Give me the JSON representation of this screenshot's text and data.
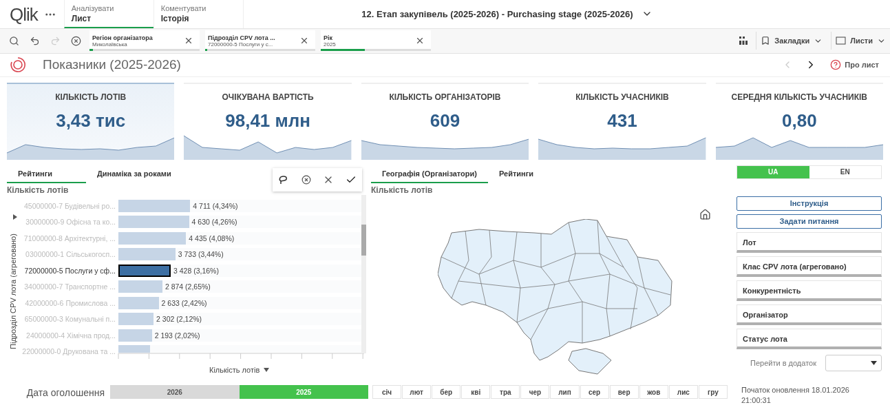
{
  "header": {
    "logo": "Qlik",
    "tabs": [
      {
        "label": "Аналізувати",
        "sublabel": "Лист",
        "selected": true
      },
      {
        "label": "Коментувати",
        "sublabel": "Історія",
        "selected": false
      }
    ],
    "app_title": "12. Етап закупівель (2025-2026) - Purchasing stage (2025-2026)"
  },
  "toolbar": {
    "redo_disabled": true,
    "selections": [
      {
        "field": "Регіон організатора",
        "value": "Миколаївська",
        "level": 0.03
      },
      {
        "field": "Підрозділ CPV лота ...",
        "value": "72000000-5 Послуги у с...",
        "level": 0.02
      },
      {
        "field": "Рік",
        "value": "2025",
        "level": 0.4
      }
    ],
    "bookmarks": "Закладки",
    "sheets": "Листи"
  },
  "sheet": {
    "title": "Показники (2025-2026)",
    "prev_disabled": true,
    "about": "Про лист"
  },
  "kpis": [
    {
      "title": "КІЛЬКІСТЬ ЛОТІВ",
      "value": "3,43 тис",
      "selected": true
    },
    {
      "title": "ОЧІКУВАНА ВАРТІСТЬ",
      "value": "98,41 млн",
      "selected": false
    },
    {
      "title": "КІЛЬКІСТЬ ОРГАНІЗАТОРІВ",
      "value": "609",
      "selected": false
    },
    {
      "title": "КІЛЬКІСТЬ УЧАСНИКІВ",
      "value": "431",
      "selected": false
    },
    {
      "title": "СЕРЕДНЯ КІЛЬКІСТЬ УЧАСНИКІВ",
      "value": "0,80",
      "selected": false
    }
  ],
  "ratings_panel": {
    "tabs": [
      {
        "label": "Рейтинги",
        "selected": true
      },
      {
        "label": "Динаміка за роками",
        "selected": false
      }
    ],
    "subtitle": "Кількість лотів",
    "y_axis_title": "Підрозділ CPV лота (агреговано)",
    "x_axis_title": "Кількість лотів",
    "bars": [
      {
        "label": "45000000-7 Будівельні ро...",
        "value": "4 711 (4,34%)",
        "level": 0.294,
        "selected": false
      },
      {
        "label": "30000000-9 Офісна та ко...",
        "value": "4 630 (4,26%)",
        "level": 0.289,
        "selected": false
      },
      {
        "label": "71000000-8 Архітектурні, ...",
        "value": "4 435 (4,08%)",
        "level": 0.277,
        "selected": false
      },
      {
        "label": "03000000-1 Сільськогосп...",
        "value": "3 733 (3,44%)",
        "level": 0.233,
        "selected": false
      },
      {
        "label": "72000000-5 Послуги у сф...",
        "value": "3 428 (3,16%)",
        "level": 0.214,
        "selected": true
      },
      {
        "label": "34000000-7 Транспортне ...",
        "value": "2 874 (2,65%)",
        "level": 0.18,
        "selected": false
      },
      {
        "label": "42000000-6 Промислова ...",
        "value": "2 633 (2,42%)",
        "level": 0.165,
        "selected": false
      },
      {
        "label": "65000000-3 Комунальні п...",
        "value": "2 302 (2,12%)",
        "level": 0.144,
        "selected": false
      },
      {
        "label": "24000000-4 Хімічна прод...",
        "value": "2 193 (2,02%)",
        "level": 0.137,
        "selected": false
      },
      {
        "label": "22000000-0 Друкована та ...",
        "level": 0.13,
        "selected": false
      }
    ]
  },
  "map_panel": {
    "tabs": [
      {
        "label": "Географія (Організатори)",
        "selected": true
      },
      {
        "label": "Рейтинги",
        "selected": false
      }
    ],
    "subtitle": "Кількість лотів"
  },
  "side": {
    "languages": [
      {
        "label": "UA",
        "selected": true
      },
      {
        "label": "EN",
        "selected": false
      }
    ],
    "buttons": [
      "Інструкція",
      "Задати питання"
    ],
    "filters": [
      "Лот",
      "Клас CPV лота (агреговано)",
      "Конкурентність",
      "Організатор",
      "Статус лота"
    ],
    "goto_label": "Перейти в додаток",
    "update_text": "Початок оновлення 18.01.2026 21:00:31"
  },
  "date_filter": {
    "label": "Дата оголошення",
    "years": [
      {
        "label": "2026",
        "selected": false
      },
      {
        "label": "2025",
        "selected": true
      }
    ],
    "months": [
      {
        "label": "січ",
        "selected": false
      },
      {
        "label": "лют",
        "selected": false
      },
      {
        "label": "бер",
        "selected": false
      },
      {
        "label": "кві",
        "selected": false
      },
      {
        "label": "тра",
        "selected": false
      },
      {
        "label": "чер",
        "selected": false
      },
      {
        "label": "лип",
        "selected": false
      },
      {
        "label": "сер",
        "selected": false
      },
      {
        "label": "вер",
        "selected": false
      },
      {
        "label": "жов",
        "selected": false
      },
      {
        "label": "лис",
        "selected": false
      },
      {
        "label": "гру",
        "selected": false
      }
    ]
  }
}
